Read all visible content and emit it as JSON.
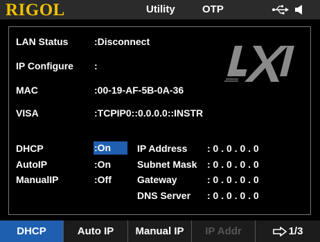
{
  "title_bar": {
    "brand": "RIGOL",
    "menu": "Utility",
    "mode": "OTP",
    "icons": [
      "usb-icon",
      "speaker-icon"
    ]
  },
  "lan_info": {
    "lan_status_label": "LAN Status",
    "lan_status_value": ":Disconnect",
    "ip_configure_label": "IP Configure",
    "ip_configure_value": ":",
    "mac_label": "MAC",
    "mac_value": ":00-19-AF-5B-0A-36",
    "visa_label": "VISA",
    "visa_value": ":TCPIP0::0.0.0.0::INSTR"
  },
  "config": {
    "dhcp_label": "DHCP",
    "dhcp_value": ":On",
    "autoip_label": "AutoIP",
    "autoip_value": ":On",
    "manualip_label": "ManualIP",
    "manualip_value": ":Off"
  },
  "network": {
    "ip_address_label": "IP Address",
    "ip_address_value": ": 0 . 0 . 0 . 0",
    "subnet_mask_label": "Subnet Mask",
    "subnet_mask_value": ": 0 . 0 . 0 . 0",
    "gateway_label": "Gateway",
    "gateway_value": ": 0 . 0 . 0 . 0",
    "dns_server_label": "DNS Server",
    "dns_server_value": ": 0 . 0 . 0 . 0"
  },
  "softkeys": {
    "dhcp": "DHCP",
    "auto_ip": "Auto IP",
    "manual_ip": "Manual IP",
    "ip_addr": "IP Addr",
    "page": "1/3"
  },
  "colors": {
    "brand": "#f0c000",
    "highlight": "#1f5fb0",
    "background": "#000000",
    "titlebar": "#2b2b2b",
    "disabled_text": "#555555"
  }
}
